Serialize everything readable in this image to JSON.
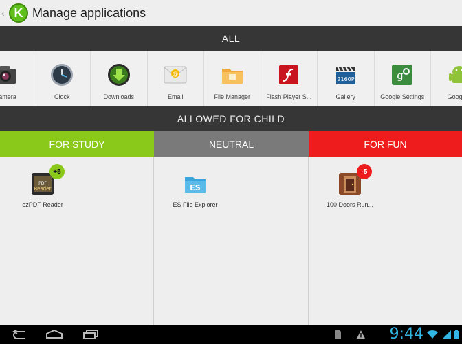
{
  "header": {
    "title": "Manage applications",
    "logo_letter": "K"
  },
  "sections": {
    "all_label": "ALL",
    "allowed_label": "ALLOWED FOR CHILD"
  },
  "apps": [
    {
      "label": "Camera",
      "icon": "camera-icon"
    },
    {
      "label": "Clock",
      "icon": "clock-icon"
    },
    {
      "label": "Downloads",
      "icon": "downloads-icon"
    },
    {
      "label": "Email",
      "icon": "email-icon"
    },
    {
      "label": "File Manager",
      "icon": "folder-icon"
    },
    {
      "label": "Flash Player S...",
      "icon": "flash-icon"
    },
    {
      "label": "Gallery",
      "icon": "gallery-icon"
    },
    {
      "label": "Google Settings",
      "icon": "google-settings-icon"
    },
    {
      "label": "Google+",
      "icon": "android-icon"
    }
  ],
  "categories": {
    "study": {
      "label": "FOR STUDY",
      "color": "#8ac81a"
    },
    "neutral": {
      "label": "NEUTRAL",
      "color": "#7a7a7a"
    },
    "fun": {
      "label": "FOR FUN",
      "color": "#ee1c1c"
    }
  },
  "assigned": {
    "study": {
      "label": "ezPDF Reader",
      "badge": "+5"
    },
    "neutral": {
      "label": "ES File Explorer"
    },
    "fun": {
      "label": "100 Doors Run...",
      "badge": "-5"
    }
  },
  "status": {
    "time": "9:44"
  }
}
